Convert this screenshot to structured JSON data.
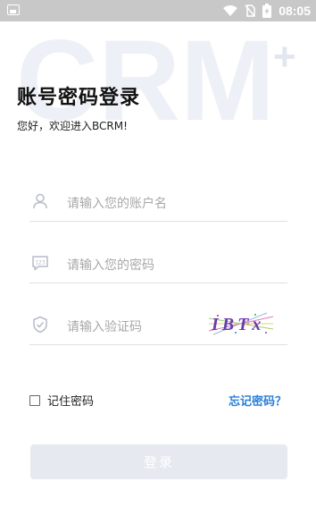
{
  "status_bar": {
    "time": "08:05"
  },
  "watermark": {
    "text": "CRM",
    "plus": "+"
  },
  "header": {
    "title": "账号密码登录",
    "subtitle": "您好，欢迎进入BCRM!"
  },
  "form": {
    "username_placeholder": "请输入您的账户名",
    "password_placeholder": "请输入您的密码",
    "code_placeholder": "请输入验证码",
    "captcha_text": "IBTx"
  },
  "options": {
    "remember_label": "记住密码",
    "remember_checked": false,
    "forgot_label": "忘记密码？"
  },
  "login_button": "登录",
  "colors": {
    "link": "#2b7fd6",
    "button_disabled": "#e6e9f0",
    "watermark": "#edf0f6",
    "icon": "#b6bcc8"
  }
}
